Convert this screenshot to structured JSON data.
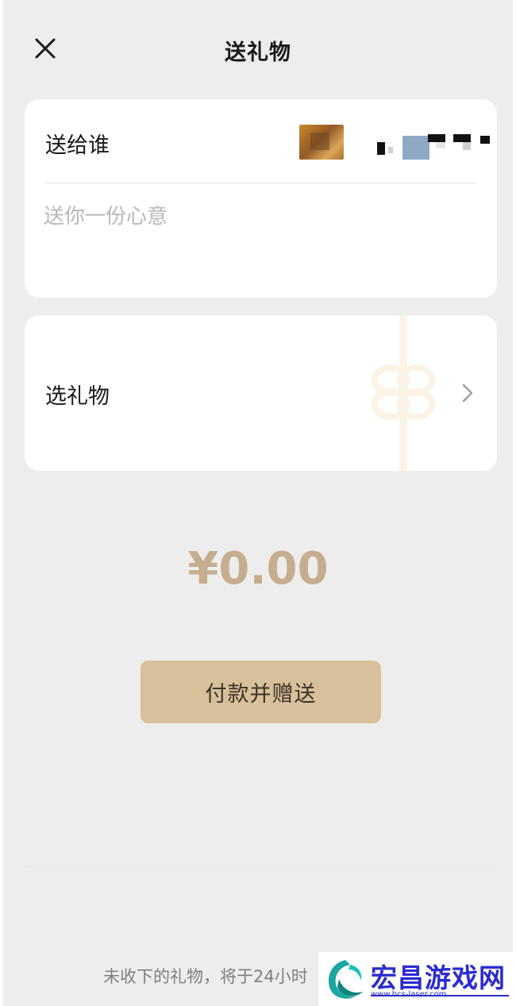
{
  "header": {
    "title": "送礼物",
    "close_icon": "close-icon"
  },
  "recipient_card": {
    "label": "送给谁",
    "message_placeholder": "送你一份心意",
    "message_value": ""
  },
  "gift_card": {
    "label": "选礼物",
    "chevron_icon": "chevron-right-icon",
    "decoration_icon": "gift-bow-icon"
  },
  "amount": "¥0.00",
  "pay_button": {
    "label": "付款并赠送"
  },
  "footnote": "未收下的礼物，将于24小时",
  "watermark": {
    "text": "宏昌游戏网",
    "url": "www.hcs-laser.com"
  },
  "colors": {
    "background": "#ededed",
    "card": "#ffffff",
    "amount": "#c6ad8e",
    "button": "#d8c09b",
    "watermark": "#2b2bd0"
  }
}
